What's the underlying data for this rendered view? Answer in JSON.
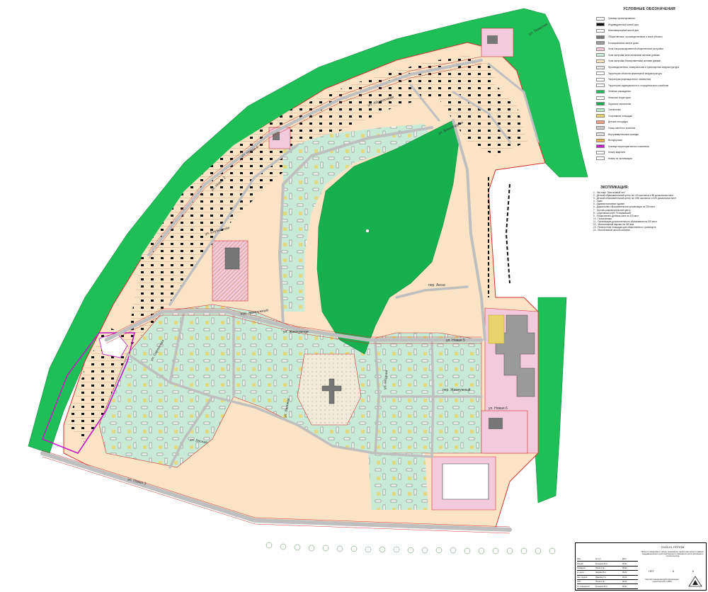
{
  "legend": {
    "title": "УСЛОВНЫЕ ОБОЗНАЧЕНИЯ",
    "items": [
      {
        "label": "Границы проектирования",
        "color": "#ffffff"
      },
      {
        "label": "Индивидуальный жилой дом",
        "color": "#111111"
      },
      {
        "label": "Многоквартирный жилой дом",
        "color": "#ffffff"
      },
      {
        "label": "Общественные, производственные и иные объекты",
        "color": "#777777"
      },
      {
        "label": "Блокированные жилые дома",
        "color": "#999999"
      },
      {
        "label": "Зона специализированной общественной застройки",
        "color": "#f3c9dc"
      },
      {
        "label": "Зона застройки многоэтажными жилыми домами",
        "color": "#c9ead6"
      },
      {
        "label": "Зона застройки блокированными жилыми домами",
        "color": "#fbe3c6"
      },
      {
        "label": "Производственная, коммунальная и транспортная инфраструктура",
        "color": "#e8e8e8"
      },
      {
        "label": "Территории объектов инженерной инфраструктуры",
        "color": "#ffffff"
      },
      {
        "label": "Территории рекреационного назначения",
        "color": "#ffffff"
      },
      {
        "label": "Территории садоводческого и огороднического хозяйства",
        "color": "#ffffff"
      },
      {
        "label": "Зелёные насаждения",
        "color": "#1fbf57"
      },
      {
        "label": "Нежилые территории",
        "color": "#ffffff"
      },
      {
        "label": "Парковое озеленение",
        "color": "#17b04f"
      },
      {
        "label": "Озеленение",
        "color": "#b8e8c4"
      },
      {
        "label": "Спортивные площадки",
        "color": "#e8d46a"
      },
      {
        "label": "Детские площадки",
        "color": "#e9a07a"
      },
      {
        "label": "Улицы местного значения",
        "color": "#cccccc"
      },
      {
        "label": "Внутриквартальные проезды",
        "color": "#dddddd"
      },
      {
        "label": "Велодорожки",
        "color": "#f0b04a"
      },
      {
        "label": "Граница территории жилого комплекса",
        "color": "#c21bc7"
      },
      {
        "label": "Номер квартала",
        "color": "#ffffff"
      },
      {
        "label": "Номер по экспликации",
        "color": "#ffffff"
      }
    ]
  },
  "explication": {
    "title": "ЭКСПЛИКАЦИЯ:",
    "items": [
      "1 - Эко-парк \"Шестаковый лес\"",
      "2 - Детский образовательный центр на 130 школьных и 80 дошкольных мест",
      "3 - Детский образовательный центр на 1050 школьных и 325 дошкольных мест",
      "4 - Храм",
      "5 - Административное здание",
      "6 - Дошкольная образовательная организация на 250 мест",
      "7 - Торгово-развлекательный центр",
      "8 - Спортивный клуб \"Олимпийский\"",
      "9 - Общественно-деловая зона на 115 мест",
      "10 - Поликлиника",
      "11 - Организация дополнительного образования на 320 мест",
      "12 - Многоэтажный паркинг на 320 м/м",
      "13 - Разворотная площадка для общественного транспорта",
      "14 - Малоэтажный жилой комплекс"
    ]
  },
  "streets": {
    "s1": "ул. Абрикосовая",
    "s2": "ул. Новая 4",
    "s3": "ул. Новая 2",
    "s4": "ул. Клубничная",
    "s5": "ул. Виноградная",
    "s6": "пер. Жемчужный",
    "s7": "ул. Жемчужная",
    "s8": "ул. Новая 5",
    "s9": "ул. Новая 6",
    "s10": "пер. Жемчужный",
    "s11": "ул. Лесная",
    "s12": "ул. Новая 3",
    "s13": "ул. Сиреневая",
    "s14": "пер. Аксас",
    "s15": "ул. Ягодная",
    "s16": "ул. Липовая",
    "s17": "ул. Тенистая"
  },
  "road_label": "ул. Тенистая",
  "stamp": {
    "code": "21/09-01-ППТ/ПМ",
    "description": "Проект планировки и проект межевания территории жилого района, предназначенного для комплексного освоения в целях жилищного строительства",
    "stage_label": "Стадия",
    "stage": "ППТ",
    "sheet_label": "Лист",
    "sheet": "6",
    "sheets_label": "Листов",
    "sheets": "6",
    "drawing_title": "Чертёж планировочной организации территории М 1:2000",
    "signatures": [
      {
        "role": "Изм.",
        "name": "Кол.уч",
        "date": "Дата"
      },
      {
        "role": "Разраб.",
        "name": "Кузьмина М.А.",
        "date": "09.22"
      },
      {
        "role": "Проверил",
        "name": "Попов С.Е.",
        "date": "09.22"
      },
      {
        "role": "Н. контр.",
        "name": "Шарова В.Н.",
        "date": "09.22"
      },
      {
        "role": "Нач. отдела",
        "name": "Иванова Т.А.",
        "date": "09.22"
      },
      {
        "role": "ГИП",
        "name": "Попов С.Е.",
        "date": "09.22"
      },
      {
        "role": "Гл. специалист",
        "name": "Кузьмина М.А.",
        "date": "09.22"
      }
    ]
  },
  "colors": {
    "forest": "#1fbf57",
    "park": "#17b04f",
    "residential_low": "#fbe3c6",
    "residential_high": "#c9ead6",
    "public": "#f3c9dc",
    "road": "#cfcfcf",
    "red_line": "#d0312d",
    "boundary": "#c21bc7"
  }
}
